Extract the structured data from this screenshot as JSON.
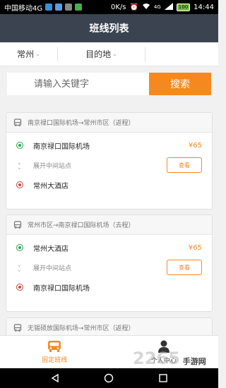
{
  "status_bar": {
    "carrier": "中国移动4G",
    "speed": "0K/s",
    "network": "4G",
    "battery": "100",
    "time": "14:44"
  },
  "header": {
    "title": "班线列表"
  },
  "filters": {
    "city": "常州",
    "destination": "目的地"
  },
  "search": {
    "placeholder": "请输入关键字",
    "button": "搜索"
  },
  "routes": [
    {
      "title": "南京禄口国际机场→常州市区（返程）",
      "start": "南京禄口国际机场",
      "middle": "展开中间站点",
      "end": "常州大酒店",
      "price": "¥65",
      "view": "查看"
    },
    {
      "title": "常州市区→南京禄口国际机场（去程）",
      "start": "常州大酒店",
      "middle": "展开中间站点",
      "end": "南京禄口国际机场",
      "price": "¥65",
      "view": "查看"
    },
    {
      "title": "无锡硕放国际机场→常州市区（返程）"
    }
  ],
  "tabs": [
    {
      "label": "固定班线",
      "icon": "bus-icon",
      "active": true
    },
    {
      "label": "个人中心",
      "icon": "person-icon",
      "active": false
    }
  ],
  "watermark": {
    "number": "2265",
    "brand": "手游网"
  },
  "colors": {
    "accent": "#f5891f",
    "header_bg": "#3b4350",
    "green": "#2aa64e",
    "red": "#d0453a"
  }
}
